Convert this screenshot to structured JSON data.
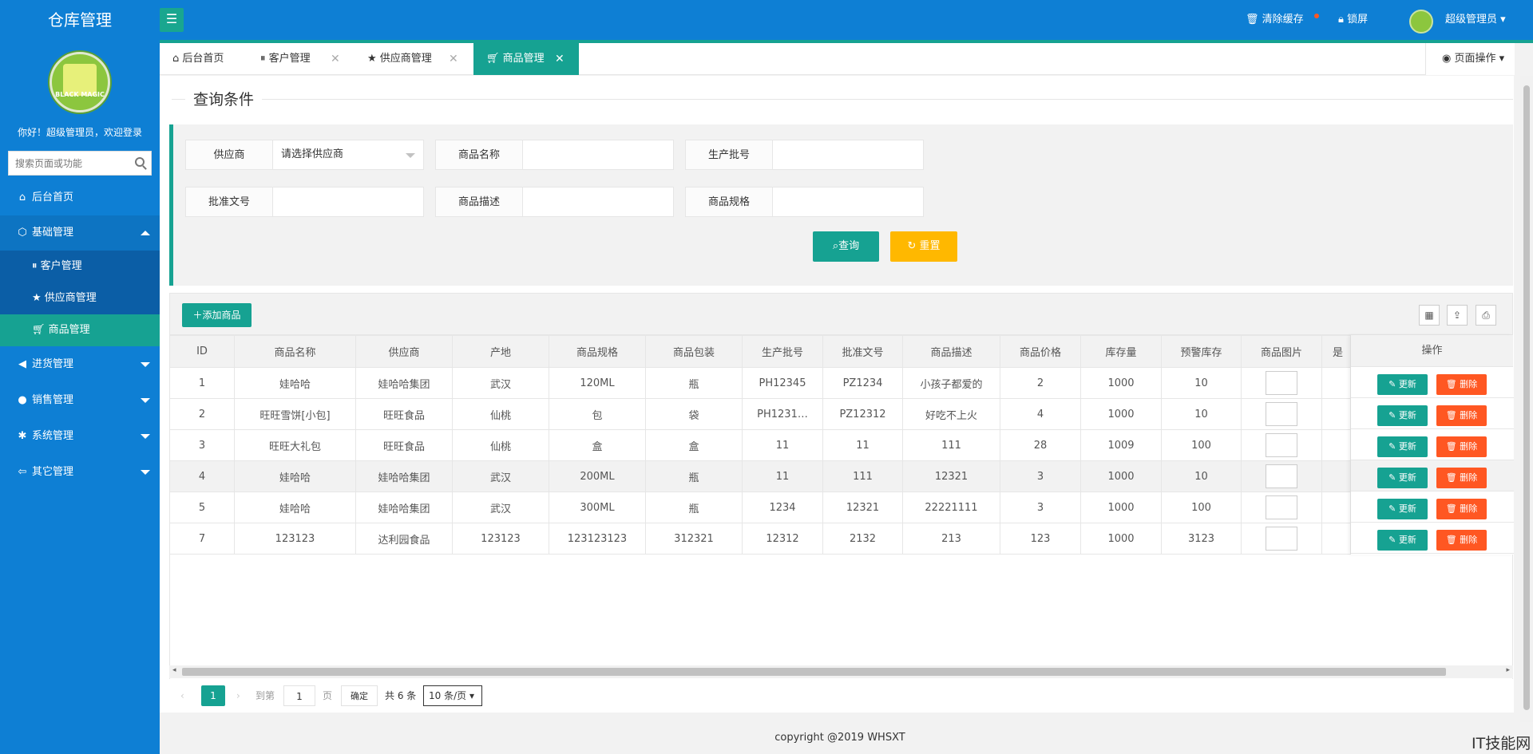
{
  "app": {
    "title": "仓库管理"
  },
  "sidebar": {
    "welcome": "你好！超级管理员，欢迎登录",
    "logo_text": "BLACK MAGIC",
    "search_placeholder": "搜索页面或功能",
    "items": [
      {
        "label": "后台首页",
        "icon": "home-icon"
      },
      {
        "label": "基础管理",
        "icon": "cube-icon",
        "expanded": true
      },
      {
        "label": "客户管理",
        "icon": "pause-circle-icon",
        "sub": true
      },
      {
        "label": "供应商管理",
        "icon": "star-icon",
        "sub": true
      },
      {
        "label": "商品管理",
        "icon": "cart-icon",
        "sub": true,
        "active": true
      },
      {
        "label": "进货管理",
        "icon": "speaker-icon"
      },
      {
        "label": "销售管理",
        "icon": "chat-icon"
      },
      {
        "label": "系统管理",
        "icon": "gear-icon"
      },
      {
        "label": "其它管理",
        "icon": "exit-icon"
      }
    ]
  },
  "header": {
    "menu_icon": "hamburger-icon",
    "clear_cache": "清除缓存",
    "lock": "锁屏",
    "user": "超级管理员"
  },
  "tabs": [
    {
      "label": "后台首页",
      "icon": "home-icon",
      "closable": false
    },
    {
      "label": "客户管理",
      "icon": "pause-circle-icon",
      "closable": true
    },
    {
      "label": "供应商管理",
      "icon": "star-icon",
      "closable": true
    },
    {
      "label": "商品管理",
      "icon": "cart-icon",
      "closable": true,
      "active": true
    }
  ],
  "page_operation": "页面操作",
  "query": {
    "legend": "查询条件",
    "supplier_label": "供应商",
    "supplier_value": "请选择供应商",
    "goods_name_label": "商品名称",
    "batch_label": "生产批号",
    "approval_label": "批准文号",
    "desc_label": "商品描述",
    "spec_label": "商品规格",
    "search_btn": "查询",
    "reset_btn": "重置"
  },
  "toolbar": {
    "add_btn": "添加商品"
  },
  "table": {
    "headers": [
      "ID",
      "商品名称",
      "供应商",
      "产地",
      "商品规格",
      "商品包装",
      "生产批号",
      "批准文号",
      "商品描述",
      "商品价格",
      "库存量",
      "预警库存",
      "商品图片",
      "是"
    ],
    "op_header": "操作",
    "rows": [
      [
        "1",
        "娃哈哈",
        "娃哈哈集团",
        "武汉",
        "120ML",
        "瓶",
        "PH12345",
        "PZ1234",
        "小孩子都爱的",
        "2",
        "1000",
        "10"
      ],
      [
        "2",
        "旺旺雪饼[小包]",
        "旺旺食品",
        "仙桃",
        "包",
        "袋",
        "PH1231…",
        "PZ12312",
        "好吃不上火",
        "4",
        "1000",
        "10"
      ],
      [
        "3",
        "旺旺大礼包",
        "旺旺食品",
        "仙桃",
        "盒",
        "盒",
        "11",
        "11",
        "111",
        "28",
        "1009",
        "100"
      ],
      [
        "4",
        "娃哈哈",
        "娃哈哈集团",
        "武汉",
        "200ML",
        "瓶",
        "11",
        "111",
        "12321",
        "3",
        "1000",
        "10"
      ],
      [
        "5",
        "娃哈哈",
        "娃哈哈集团",
        "武汉",
        "300ML",
        "瓶",
        "1234",
        "12321",
        "22221111",
        "3",
        "1000",
        "100"
      ],
      [
        "7",
        "123123",
        "达利园食品",
        "123123",
        "123123123",
        "312321",
        "12312",
        "2132",
        "213",
        "123",
        "1000",
        "3123"
      ]
    ],
    "update_btn": "更新",
    "delete_btn": "删除"
  },
  "pager": {
    "current": "1",
    "goto_label": "到第",
    "goto_value": "1",
    "page_unit": "页",
    "confirm": "确定",
    "total": "共 6 条",
    "per_page": "10 条/页"
  },
  "footer": "copyright @2019 WHSXT",
  "watermark": "IT技能网",
  "colors": {
    "primary": "#0e7fd4",
    "accent": "#16a292",
    "warn": "#ffb800",
    "danger": "#ff5722"
  }
}
